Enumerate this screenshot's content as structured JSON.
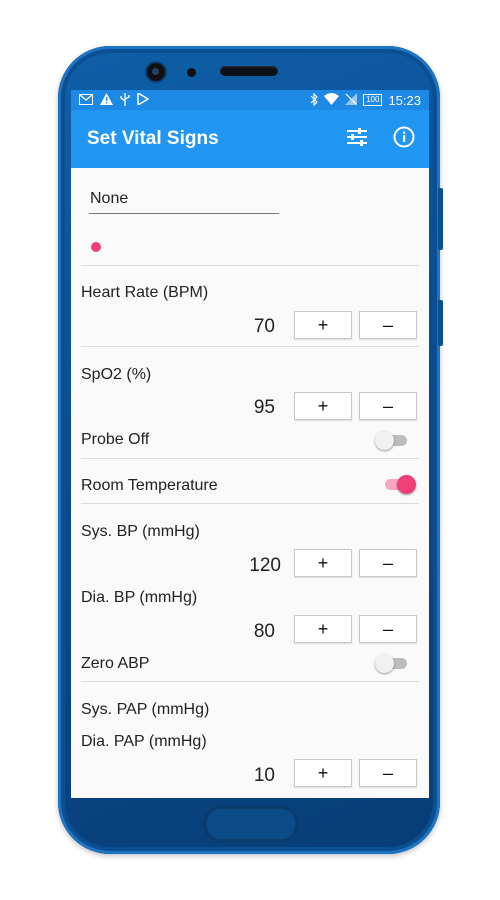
{
  "status_bar": {
    "left_icons": [
      "gmail-icon",
      "warning-icon",
      "usb-icon",
      "play-store-icon"
    ],
    "right_icons": [
      "bluetooth-icon",
      "wifi-icon",
      "no-sim-icon"
    ],
    "battery": "100",
    "time": "15:23"
  },
  "app_bar": {
    "title": "Set Vital Signs",
    "actions": [
      "tune-icon",
      "info-icon"
    ]
  },
  "selector": {
    "value": "None"
  },
  "vitals": {
    "heart_rate": {
      "label": "Heart Rate (BPM)",
      "value": "70"
    },
    "spo2": {
      "label": "SpO2 (%)",
      "value": "95"
    },
    "probe_off": {
      "label": "Probe Off",
      "on": false
    },
    "room_temp": {
      "label": "Room Temperature",
      "on": true
    },
    "sys_bp": {
      "label": "Sys. BP (mmHg)",
      "value": "120"
    },
    "dia_bp": {
      "label": "Dia. BP (mmHg)",
      "value": "80"
    },
    "zero_abp": {
      "label": "Zero ABP",
      "on": false
    },
    "sys_pap": {
      "label": "Sys. PAP (mmHg)"
    },
    "dia_pap": {
      "label": "Dia. PAP (mmHg)",
      "value": "10"
    }
  },
  "buttons": {
    "plus": "+",
    "minus": "–"
  },
  "colors": {
    "status": "#1E88E5",
    "appbar": "#2196F3",
    "accent": "#EC407A"
  }
}
